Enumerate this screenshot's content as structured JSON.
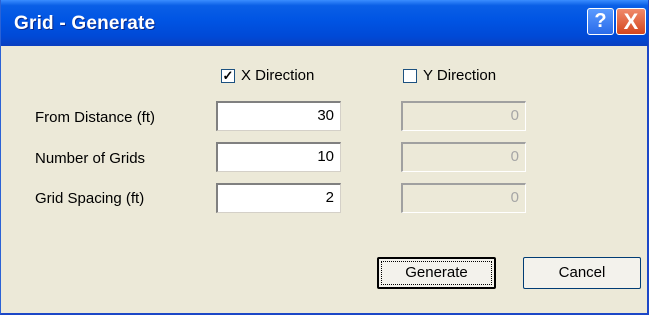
{
  "window": {
    "title": "Grid - Generate"
  },
  "titlebar_buttons": {
    "help": "?",
    "close": "X"
  },
  "columns": {
    "x": {
      "label": "X Direction",
      "checked": true,
      "check_mark": "✓"
    },
    "y": {
      "label": "Y Direction",
      "checked": false,
      "check_mark": ""
    }
  },
  "rows": [
    {
      "label": "From Distance (ft)",
      "x_value": "30",
      "y_value": "0"
    },
    {
      "label": "Number of Grids",
      "x_value": "10",
      "y_value": "0"
    },
    {
      "label": "Grid Spacing (ft)",
      "x_value": "2",
      "y_value": "0"
    }
  ],
  "buttons": {
    "generate": "Generate",
    "cancel": "Cancel"
  }
}
